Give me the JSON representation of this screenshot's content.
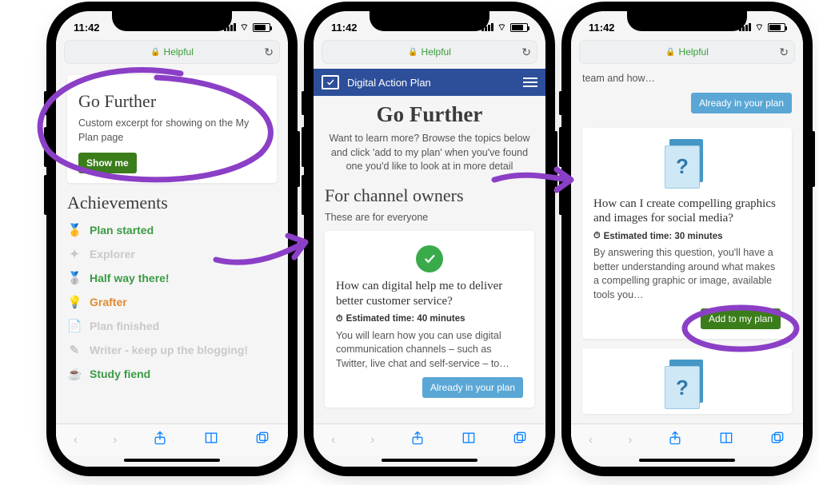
{
  "status": {
    "time": "11:42"
  },
  "browser": {
    "host": "Helpful"
  },
  "phone1": {
    "go_further": {
      "title": "Go Further",
      "excerpt": "Custom excerpt for showing on the My Plan page",
      "button": "Show me"
    },
    "achievements": {
      "title": "Achievements",
      "items": [
        {
          "icon": "🥇",
          "label": "Plan started",
          "done": true
        },
        {
          "icon": "✦",
          "label": "Explorer",
          "done": false
        },
        {
          "icon": "🥈",
          "label": "Half way there!",
          "done": true
        },
        {
          "icon": "💡",
          "label": "Grafter",
          "done": true,
          "orange": true
        },
        {
          "icon": "📄",
          "label": "Plan finished",
          "done": false
        },
        {
          "icon": "✎",
          "label": "Writer - keep up the blogging!",
          "done": false
        },
        {
          "icon": "☕",
          "label": "Study fiend",
          "done": true
        }
      ]
    }
  },
  "phone2": {
    "header": "Digital Action Plan",
    "title": "Go Further",
    "intro": "Want to learn more? Browse the topics below and click 'add to my plan' when you've found one you'd like to look at in more detail",
    "section_title": "For channel owners",
    "section_sub": "These are for everyone",
    "card": {
      "title": "How can digital help me to deliver better customer service?",
      "est": "Estimated time: 40 minutes",
      "body": "You will learn how you can use digital communication channels – such as Twitter, live chat and self-service – to…",
      "button": "Already in your plan"
    }
  },
  "phone3": {
    "top_fragment": "team and how…",
    "top_button": "Already in your plan",
    "card": {
      "title": "How can I create compelling graphics and images for social media?",
      "est": "Estimated time: 30 minutes",
      "body": "By answering this question, you'll have a better understanding around what makes a compelling graphic or image, available tools you…",
      "button": "Add to my plan"
    }
  }
}
